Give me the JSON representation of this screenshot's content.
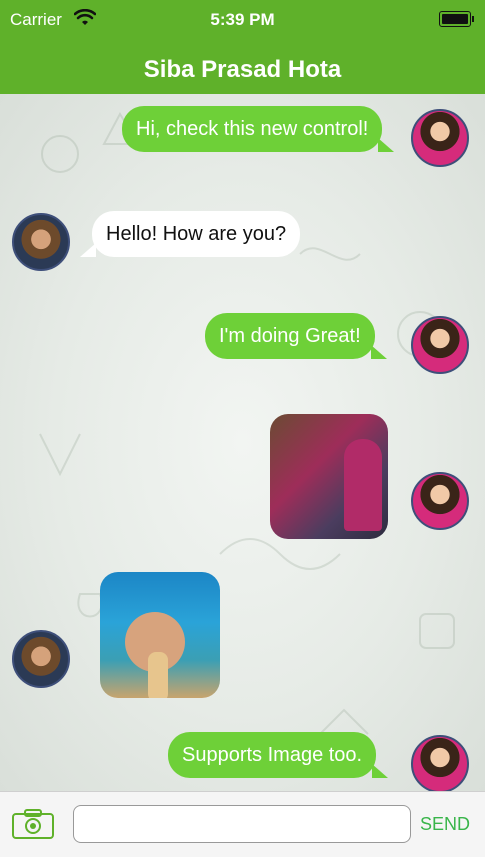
{
  "status_bar": {
    "carrier": "Carrier",
    "time": "5:39 PM"
  },
  "header": {
    "title": "Siba Prasad Hota"
  },
  "messages": [
    {
      "text": "Hi, check this new control!"
    },
    {
      "text": "Hello! How are you?"
    },
    {
      "text": "I'm doing Great!"
    },
    {
      "text": ""
    },
    {
      "text": ""
    },
    {
      "text": "Supports Image too."
    }
  ],
  "input_bar": {
    "placeholder": "",
    "send_label": "SEND"
  },
  "colors": {
    "header_green": "#5fb12a",
    "bubble_green": "#6ed038",
    "send_green": "#39b54a"
  }
}
